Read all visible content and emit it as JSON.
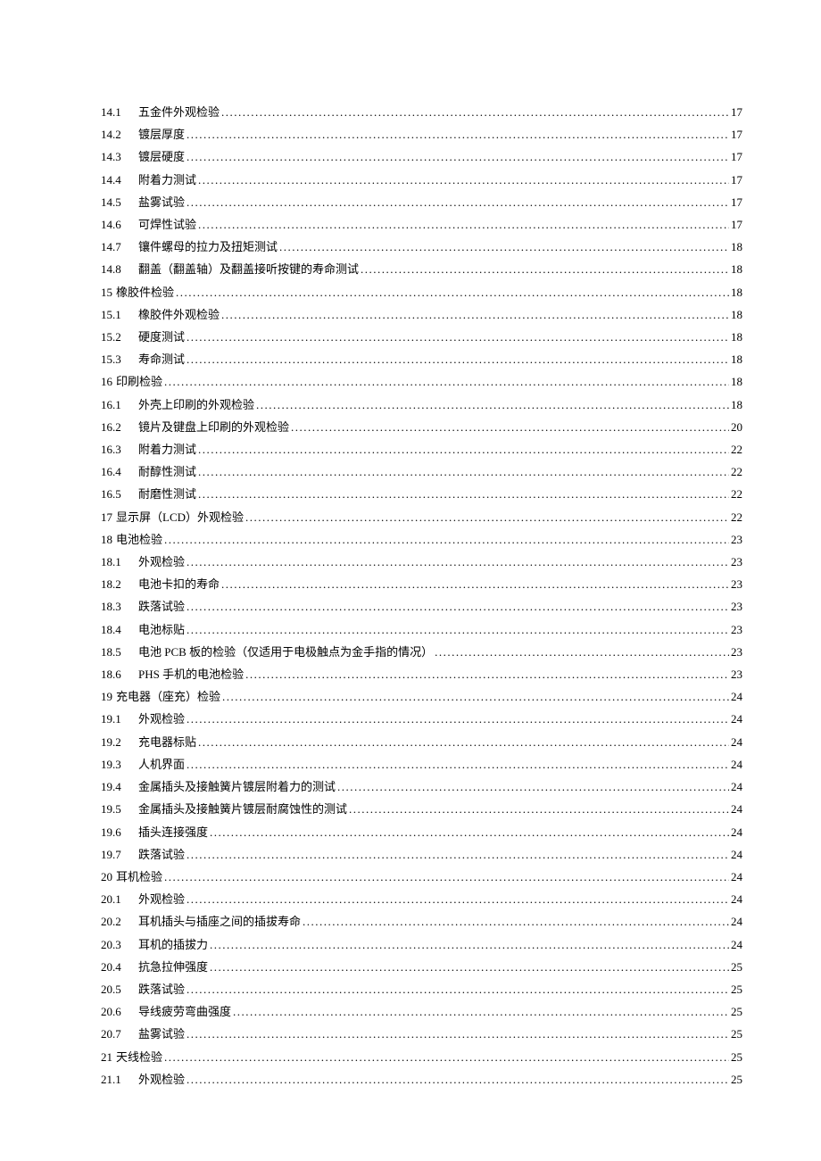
{
  "entries": [
    {
      "num": "14.1",
      "title": "五金件外观检验",
      "page": "17",
      "level": "sub"
    },
    {
      "num": "14.2",
      "title": "镀层厚度",
      "page": "17",
      "level": "sub"
    },
    {
      "num": "14.3",
      "title": "镀层硬度",
      "page": "17",
      "level": "sub"
    },
    {
      "num": "14.4",
      "title": "附着力测试",
      "page": "17",
      "level": "sub"
    },
    {
      "num": "14.5",
      "title": "盐雾试验",
      "page": "17",
      "level": "sub"
    },
    {
      "num": "14.6",
      "title": "可焊性试验",
      "page": "17",
      "level": "sub"
    },
    {
      "num": "14.7",
      "title": "镶件螺母的拉力及扭矩测试",
      "page": "18",
      "level": "sub"
    },
    {
      "num": "14.8",
      "title": "翻盖（翻盖轴）及翻盖接听按键的寿命测试",
      "page": "18",
      "level": "sub"
    },
    {
      "num": "15",
      "title": "橡胶件检验",
      "page": "18",
      "level": "section"
    },
    {
      "num": "15.1",
      "title": "橡胶件外观检验",
      "page": "18",
      "level": "sub"
    },
    {
      "num": "15.2",
      "title": "硬度测试",
      "page": "18",
      "level": "sub"
    },
    {
      "num": "15.3",
      "title": "寿命测试",
      "page": "18",
      "level": "sub"
    },
    {
      "num": "16",
      "title": "印刷检验",
      "page": "18",
      "level": "section"
    },
    {
      "num": "16.1",
      "title": "外壳上印刷的外观检验",
      "page": "18",
      "level": "sub"
    },
    {
      "num": "16.2",
      "title": "镜片及键盘上印刷的外观检验",
      "page": "20",
      "level": "sub"
    },
    {
      "num": "16.3",
      "title": "附着力测试",
      "page": "22",
      "level": "sub"
    },
    {
      "num": "16.4",
      "title": "耐醇性测试",
      "page": "22",
      "level": "sub"
    },
    {
      "num": "16.5",
      "title": "耐磨性测试",
      "page": "22",
      "level": "sub"
    },
    {
      "num": "17",
      "title": "显示屏（LCD）外观检验",
      "page": "22",
      "level": "section"
    },
    {
      "num": "18",
      "title": "电池检验",
      "page": "23",
      "level": "section"
    },
    {
      "num": "18.1",
      "title": "外观检验",
      "page": "23",
      "level": "sub"
    },
    {
      "num": "18.2",
      "title": "电池卡扣的寿命",
      "page": "23",
      "level": "sub"
    },
    {
      "num": "18.3",
      "title": "跌落试验",
      "page": "23",
      "level": "sub"
    },
    {
      "num": "18.4",
      "title": "电池标贴",
      "page": "23",
      "level": "sub"
    },
    {
      "num": "18.5",
      "title": "电池 PCB 板的检验（仅适用于电极触点为金手指的情况）",
      "page": "23",
      "level": "sub"
    },
    {
      "num": "18.6",
      "title": "PHS 手机的电池检验",
      "page": "23",
      "level": "sub"
    },
    {
      "num": "19",
      "title": "充电器（座充）检验",
      "page": "24",
      "level": "section"
    },
    {
      "num": "19.1",
      "title": "外观检验",
      "page": "24",
      "level": "sub"
    },
    {
      "num": "19.2",
      "title": "充电器标贴",
      "page": "24",
      "level": "sub"
    },
    {
      "num": "19.3",
      "title": "人机界面",
      "page": "24",
      "level": "sub"
    },
    {
      "num": "19.4",
      "title": "金属插头及接触簧片镀层附着力的测试",
      "page": "24",
      "level": "sub"
    },
    {
      "num": "19.5",
      "title": "金属插头及接触簧片镀层耐腐蚀性的测试",
      "page": "24",
      "level": "sub"
    },
    {
      "num": "19.6",
      "title": "插头连接强度",
      "page": "24",
      "level": "sub"
    },
    {
      "num": "19.7",
      "title": "跌落试验",
      "page": "24",
      "level": "sub"
    },
    {
      "num": "20",
      "title": "耳机检验",
      "page": "24",
      "level": "section"
    },
    {
      "num": "20.1",
      "title": "外观检验",
      "page": "24",
      "level": "sub"
    },
    {
      "num": "20.2",
      "title": "耳机插头与插座之间的插拔寿命",
      "page": "24",
      "level": "sub"
    },
    {
      "num": "20.3",
      "title": "耳机的插拔力",
      "page": "24",
      "level": "sub"
    },
    {
      "num": "20.4",
      "title": "抗急拉伸强度",
      "page": "25",
      "level": "sub"
    },
    {
      "num": "20.5",
      "title": "跌落试验",
      "page": "25",
      "level": "sub"
    },
    {
      "num": "20.6",
      "title": "导线疲劳弯曲强度",
      "page": "25",
      "level": "sub"
    },
    {
      "num": "20.7",
      "title": "盐雾试验",
      "page": "25",
      "level": "sub"
    },
    {
      "num": "21",
      "title": "天线检验",
      "page": "25",
      "level": "section"
    },
    {
      "num": "21.1",
      "title": "外观检验",
      "page": "25",
      "level": "sub"
    }
  ]
}
